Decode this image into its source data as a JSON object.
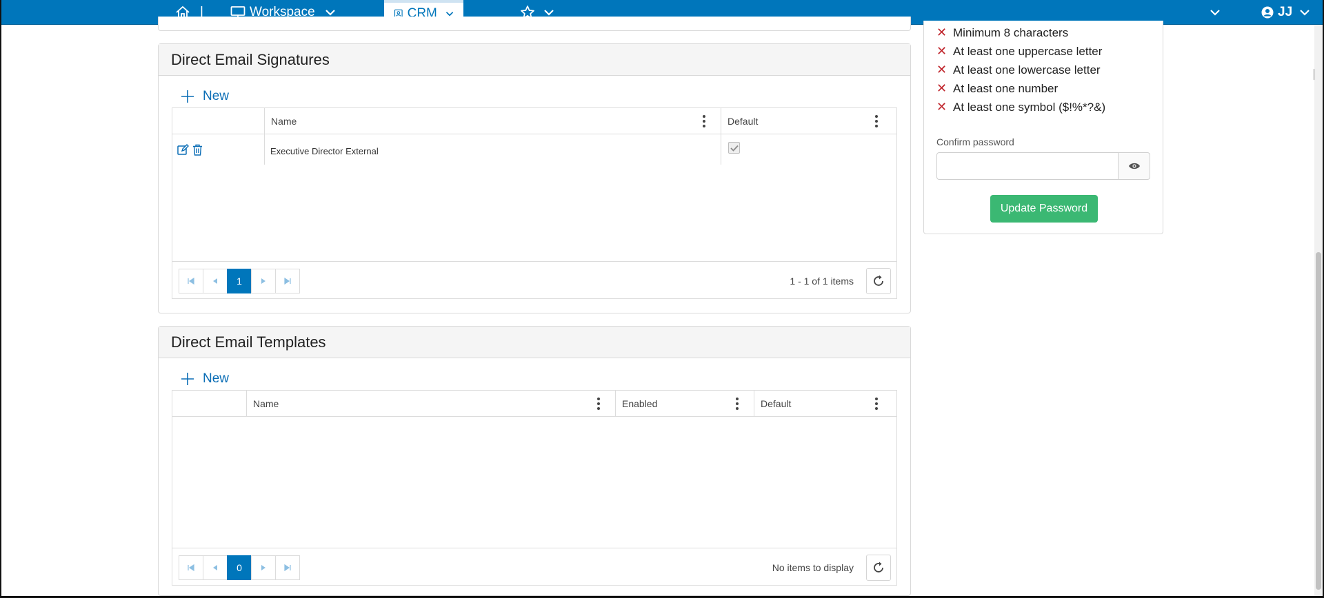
{
  "nav": {
    "separator": "|",
    "workspace": "Workspace",
    "crm": "CRM",
    "user": "JJ"
  },
  "password_rules": [
    "Minimum 8 characters",
    "At least one uppercase letter",
    "At least one lowercase letter",
    "At least one number",
    "At least one symbol ($!%*?&)"
  ],
  "password": {
    "confirm_label": "Confirm password",
    "confirm_value": "",
    "update_label": "Update Password"
  },
  "signatures": {
    "title": "Direct Email Signatures",
    "new_label": "New",
    "columns": [
      "Name",
      "Default"
    ],
    "rows": [
      {
        "name": "Executive Director External",
        "default": true
      }
    ],
    "page": "1",
    "info": "1 - 1 of 1 items"
  },
  "templates": {
    "title": "Direct Email Templates",
    "new_label": "New",
    "columns": [
      "Name",
      "Enabled",
      "Default"
    ],
    "rows": [],
    "page": "0",
    "info": "No items to display"
  },
  "colors": {
    "nav": "#0076bb",
    "link": "#0a6db5",
    "success": "#3bb873",
    "error": "#c0262d"
  }
}
